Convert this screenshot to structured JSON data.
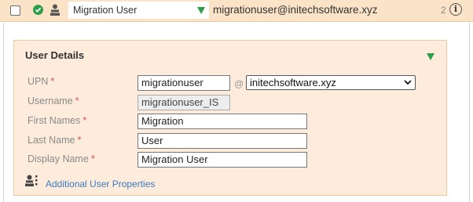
{
  "header": {
    "name_value": "Migration User",
    "email": "migrationuser@initechsoftware.xyz",
    "count": "2",
    "info_glyph": "i"
  },
  "user_details": {
    "title": "User Details",
    "fields": {
      "upn": {
        "label": "UPN",
        "required": "*",
        "value": "migrationuser"
      },
      "at_sign": "@",
      "domain": {
        "value": "initechsoftware.xyz"
      },
      "username": {
        "label": "Username",
        "required": "*",
        "value": "migrationuser_IS"
      },
      "first_names": {
        "label": "First Names",
        "required": "*",
        "value": "Migration"
      },
      "last_name": {
        "label": "Last Name",
        "required": "*",
        "value": "User"
      },
      "display_name": {
        "label": "Display Name",
        "required": "*",
        "value": "Migration User"
      }
    },
    "additional_link": "Additional User Properties"
  },
  "icons": [
    "checkbox",
    "check-circle-icon",
    "user-icon",
    "dropdown-triangle-icon",
    "info-icon",
    "user-properties-icon"
  ],
  "colors": {
    "accent_green": "#2e9e4a",
    "header_bg": "#fbe3c8",
    "card_bg": "#fdecdb",
    "link": "#3a7bbf",
    "required": "#d9534f"
  }
}
